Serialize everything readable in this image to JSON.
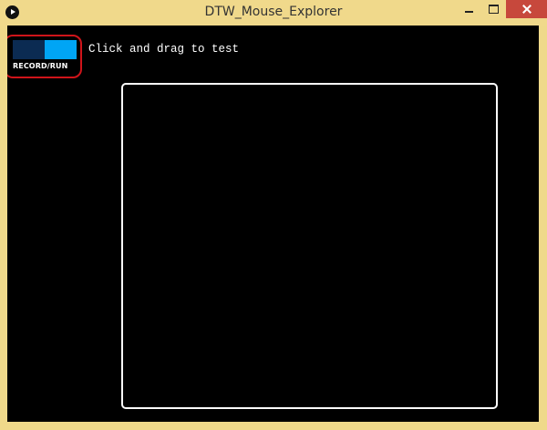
{
  "window": {
    "title": "DTW_Mouse_Explorer",
    "controls": [
      "minimize",
      "maximize",
      "close"
    ]
  },
  "toolbar": {
    "toggle_label": "RECORD/RUN",
    "toggle_colors": {
      "record": "#0b2b52",
      "run": "#00a5f5"
    }
  },
  "canvas": {
    "hint_text": "Click and drag to test",
    "background": "#000000",
    "border_color": "#ffffff"
  },
  "annotation": {
    "color": "#d0141a"
  }
}
